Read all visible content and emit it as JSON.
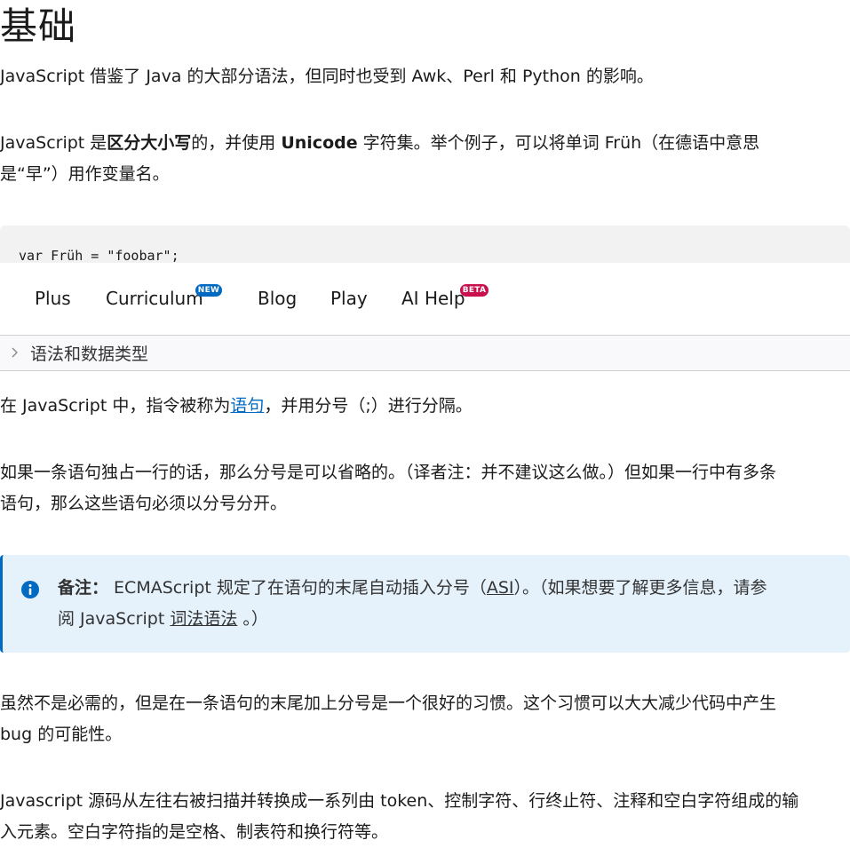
{
  "heading": "基础",
  "para1": "JavaScript 借鉴了 Java 的大部分语法，但同时也受到 Awk、Perl 和 Python 的影响。",
  "para2": {
    "pre": "JavaScript 是",
    "bold1": "区分大小写",
    "mid": "的，并使用 ",
    "bold2": "Unicode",
    "post": " 字符集。举个例子，可以将单词 Früh（在德语中意思",
    "line2": "是“早”）用作变量名。"
  },
  "code": "var Früh = \"foobar\";",
  "nav": {
    "items": [
      "Plus",
      "Curriculum",
      "Blog",
      "Play",
      "AI Help"
    ],
    "badge_new": "NEW",
    "badge_beta": "BETA"
  },
  "breadcrumb": "语法和数据类型",
  "para3": {
    "pre": "在 JavaScript 中，指令被称为",
    "link": "语句",
    "post": "，并用分号（;）进行分隔。"
  },
  "para4": {
    "line1": "如果一条语句独占一行的话，那么分号是可以省略的。（译者注：并不建议这么做。）但如果一行中有多条",
    "line2": "语句，那么这些语句必须以分号分开。"
  },
  "note": {
    "label": "备注：",
    "line1_pre": " ECMAScript 规定了在语句的末尾自动插入分号（",
    "asi_link": "ASI",
    "line1_post": "）。（如果想要了解更多信息，请参",
    "line2_pre": "阅 JavaScript ",
    "link2": "词法语法",
    "line2_post": " 。）"
  },
  "para5": {
    "line1": "虽然不是必需的，但是在一条语句的末尾加上分号是一个很好的习惯。这个习惯可以大大减少代码中产生",
    "line2": "bug 的可能性。"
  },
  "para6": {
    "line1": "Javascript 源码从左往右被扫描并转换成一系列由 token、控制字符、行终止符、注释和空白字符组成的输",
    "line2": "入元素。空白字符指的是空格、制表符和换行符等。"
  },
  "colors": {
    "link": "#0069c2",
    "note_bg": "#e5f1fb",
    "badge_new": "#0069c2",
    "badge_beta": "#c8114d"
  },
  "icons": {
    "breadcrumb": "chevron-right-icon",
    "note": "info-icon"
  }
}
